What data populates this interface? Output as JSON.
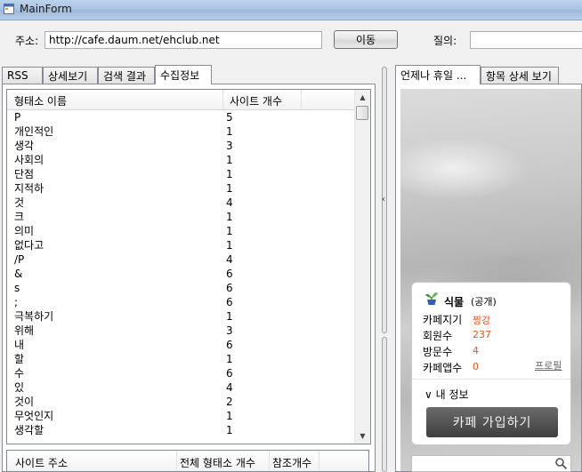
{
  "window": {
    "title": "MainForm"
  },
  "toolbar": {
    "address_label": "주소:",
    "address_value": "http://cafe.daum.net/ehclub.net",
    "go_label": "이동",
    "query_label": "질의:",
    "query_value": ""
  },
  "left_tabs": [
    "RSS",
    "상세보기",
    "검색 결과",
    "수집정보"
  ],
  "list": {
    "headers": [
      "형태소 이름",
      "사이트 개수"
    ],
    "rows": [
      [
        "P",
        "5"
      ],
      [
        "개인적인",
        "1"
      ],
      [
        "생각",
        "3"
      ],
      [
        "사회의",
        "1"
      ],
      [
        "단점",
        "1"
      ],
      [
        "지적하",
        "1"
      ],
      [
        "것",
        "4"
      ],
      [
        "크",
        "1"
      ],
      [
        "의미",
        "1"
      ],
      [
        "없다고",
        "1"
      ],
      [
        "/P",
        "4"
      ],
      [
        "&",
        "6"
      ],
      [
        "s",
        "6"
      ],
      [
        ";",
        "6"
      ],
      [
        "극복하기",
        "1"
      ],
      [
        "위해",
        "3"
      ],
      [
        "내",
        "6"
      ],
      [
        "할",
        "1"
      ],
      [
        "수",
        "6"
      ],
      [
        "있",
        "4"
      ],
      [
        "것이",
        "2"
      ],
      [
        "무엇인지",
        "1"
      ],
      [
        "생각할",
        "1"
      ]
    ]
  },
  "bottom_list": {
    "headers": [
      "사이트 주소",
      "전체 형태소 개수",
      "참조개수"
    ]
  },
  "right_tabs": [
    "언제나 휴일 ...",
    "항목 상세 보기"
  ],
  "cafe": {
    "name": "식물",
    "visibility": "(공개)",
    "manager_label": "카페지기",
    "manager_value": "짱강",
    "members_label": "회원수",
    "members_value": "237",
    "visits_label": "방문수",
    "visits_value": "4",
    "apps_label": "카페앱수",
    "apps_value": "0",
    "profile_link": "프로필",
    "my_info": "∨ 내 정보",
    "join_button": "카페 가입하기"
  },
  "colors": {
    "accent": "#e8561a",
    "tab_border": "#898c95"
  }
}
